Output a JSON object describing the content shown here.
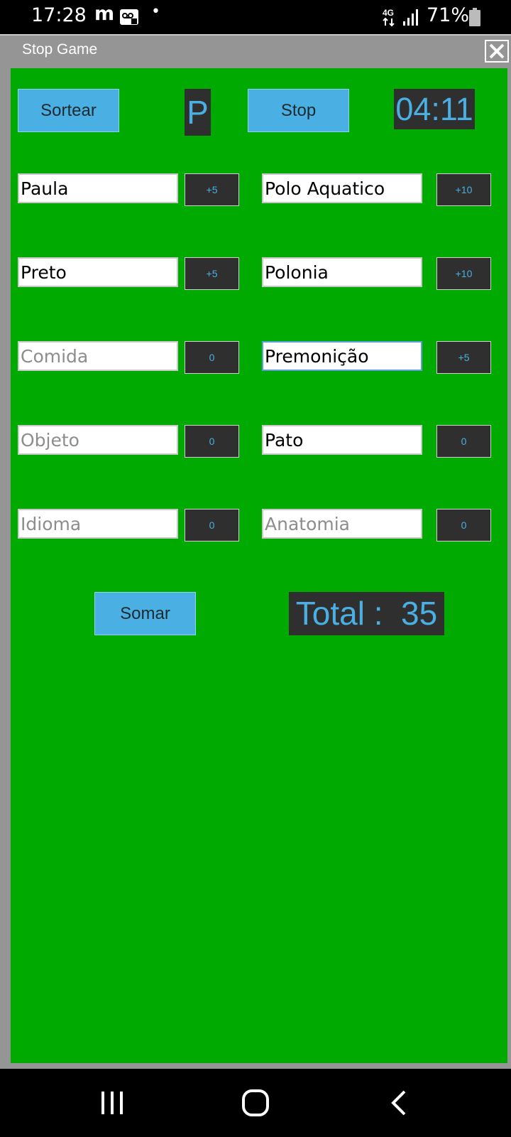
{
  "status": {
    "time": "17:28",
    "carrier_icon_text": "m",
    "network": "4G",
    "battery_pct": "71%"
  },
  "window": {
    "title": "Stop Game"
  },
  "game": {
    "sortear_label": "Sortear",
    "letter": "P",
    "stop_label": "Stop",
    "timer": "04:11",
    "rows": [
      {
        "left": {
          "value": "Paula",
          "placeholder": "",
          "score": "+5"
        },
        "right": {
          "value": "Polo Aquatico",
          "placeholder": "",
          "score": "+10"
        }
      },
      {
        "left": {
          "value": "Preto",
          "placeholder": "",
          "score": "+5"
        },
        "right": {
          "value": "Polonia",
          "placeholder": "",
          "score": "+10"
        }
      },
      {
        "left": {
          "value": "",
          "placeholder": "Comida",
          "score": "0"
        },
        "right": {
          "value": "Premonição",
          "placeholder": "",
          "score": "+5"
        }
      },
      {
        "left": {
          "value": "",
          "placeholder": "Objeto",
          "score": "0"
        },
        "right": {
          "value": "Pato",
          "placeholder": "",
          "score": "0"
        }
      },
      {
        "left": {
          "value": "",
          "placeholder": "Idioma",
          "score": "0"
        },
        "right": {
          "value": "",
          "placeholder": "Anatomia",
          "score": "0"
        }
      }
    ],
    "somar_label": "Somar",
    "total": "Total :  35"
  },
  "colors": {
    "game_bg": "#00aa00",
    "button_bg": "#4aafe2",
    "dark_box": "#2f2f2f",
    "accent_text": "#4aafe2"
  },
  "icons": [
    "voicemail-icon",
    "network-4g-icon",
    "signal-icon",
    "battery-icon",
    "close-icon",
    "recent-apps-icon",
    "home-icon",
    "back-icon"
  ]
}
